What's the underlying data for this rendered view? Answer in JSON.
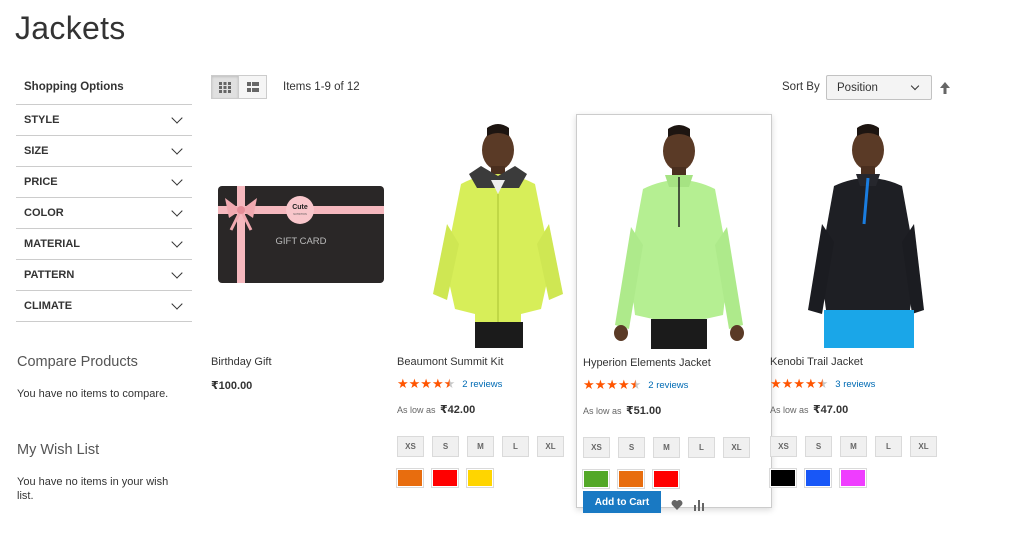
{
  "page": {
    "title": "Jackets"
  },
  "sidebar": {
    "title": "Shopping Options",
    "filters": [
      "STYLE",
      "SIZE",
      "PRICE",
      "COLOR",
      "MATERIAL",
      "PATTERN",
      "CLIMATE"
    ],
    "compare": {
      "title": "Compare Products",
      "text": "You have no items to compare."
    },
    "wishlist": {
      "title": "My Wish List",
      "text": "You have no items in your wish list."
    }
  },
  "toolbar": {
    "amount": "Items 1-9 of 12",
    "sort_label": "Sort By",
    "sort_value": "Position"
  },
  "products": [
    {
      "name": "Birthday Gift",
      "price": "₹100.00",
      "gift_card_brand": "Cute",
      "gift_card_sub": "NUTRITION",
      "gift_card_text": "GIFT CARD"
    },
    {
      "name": "Beaumont Summit Kit",
      "rating": 4.5,
      "reviews": "2 reviews",
      "price_prefix": "As low as",
      "price": "₹42.00",
      "sizes": [
        "XS",
        "S",
        "M",
        "L",
        "XL"
      ],
      "colors": [
        "#e86d0e",
        "#ff0000",
        "#ffd500"
      ]
    },
    {
      "name": "Hyperion Elements Jacket",
      "rating": 4.5,
      "reviews": "2 reviews",
      "price_prefix": "As low as",
      "price": "₹51.00",
      "sizes": [
        "XS",
        "S",
        "M",
        "L",
        "XL"
      ],
      "colors": [
        "#53a828",
        "#e86d0e",
        "#ff0000"
      ],
      "add_to_cart": "Add to Cart"
    },
    {
      "name": "Kenobi Trail Jacket",
      "rating": 4.5,
      "reviews": "3 reviews",
      "price_prefix": "As low as",
      "price": "₹47.00",
      "sizes": [
        "XS",
        "S",
        "M",
        "L",
        "XL"
      ],
      "colors": [
        "#000000",
        "#1857f7",
        "#ef3dff"
      ]
    }
  ],
  "icons": {
    "grid": "grid-icon",
    "list": "list-icon",
    "sort_direction": "arrow-up-icon",
    "wishlist": "heart-icon",
    "compare": "compare-icon"
  }
}
